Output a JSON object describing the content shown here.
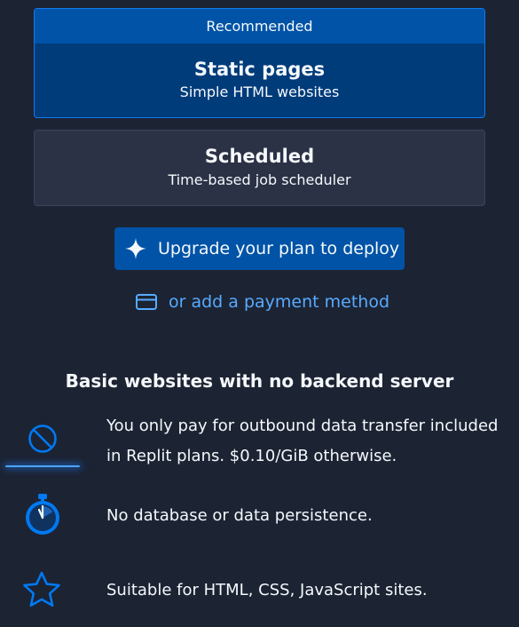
{
  "plans": {
    "static": {
      "badge": "Recommended",
      "title": "Static pages",
      "subtitle": "Simple HTML websites"
    },
    "scheduled": {
      "title": "Scheduled",
      "subtitle": "Time-based job scheduler"
    }
  },
  "actions": {
    "upgrade_label": "Upgrade your plan to deploy",
    "upgrade_icon": "sparkle-icon",
    "payment_label": "or add a payment method",
    "payment_icon": "credit-card-icon"
  },
  "details": {
    "heading": "Basic websites with no backend server",
    "features": [
      {
        "icon": "no-symbol-icon",
        "text": "You only pay for outbound data transfer included in Replit plans. $0.10/GiB otherwise."
      },
      {
        "icon": "stopwatch-icon",
        "text": "No database or data persistence."
      },
      {
        "icon": "star-icon",
        "text": "Suitable for HTML, CSS, JavaScript sites."
      }
    ]
  },
  "colors": {
    "background": "#1c2333",
    "selected_card": "#003b7a",
    "selected_border": "#0f7bf0",
    "ribbon": "#0053a6",
    "card": "#2b3245",
    "primary_button": "#0053a6",
    "link": "#57abff",
    "icon_blue": "#0079f2"
  }
}
